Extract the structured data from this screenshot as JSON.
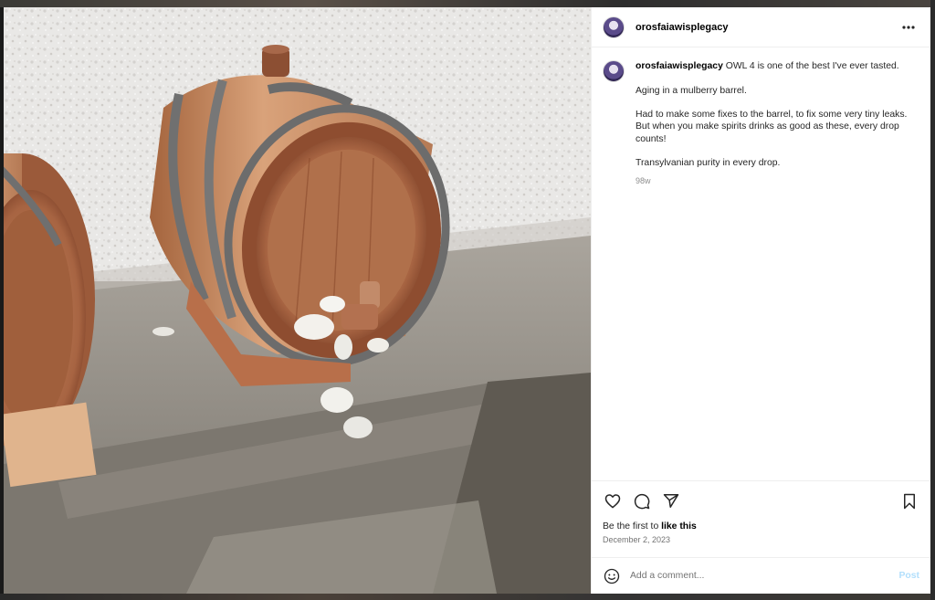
{
  "post": {
    "username": "orosfaiawisplegacy",
    "caption": {
      "username": "orosfaiawisplegacy",
      "line1": "OWL 4 is one of the best I've ever tasted.",
      "line2": "Aging in a mulberry barrel.",
      "line3": "Had to make some fixes to the barrel, to fix some very tiny leaks. But when you make spirits drinks as good as these, every drop counts!",
      "line4": "Transylvanian purity in every drop."
    },
    "time_ago": "98w",
    "likes_prefix": "Be the first to",
    "likes_link": "like this",
    "date": "December 2, 2023"
  },
  "comment_box": {
    "placeholder": "Add a comment...",
    "post_label": "Post"
  },
  "colors": {
    "post_button": "#b2dffc",
    "secondary_text": "#737373",
    "border": "#efefef"
  },
  "icons": {
    "more": "more-horizontal-icon",
    "like": "heart-icon",
    "comment": "comment-bubble-icon",
    "share": "paper-plane-icon",
    "save": "bookmark-icon",
    "emoji": "smiley-icon"
  }
}
